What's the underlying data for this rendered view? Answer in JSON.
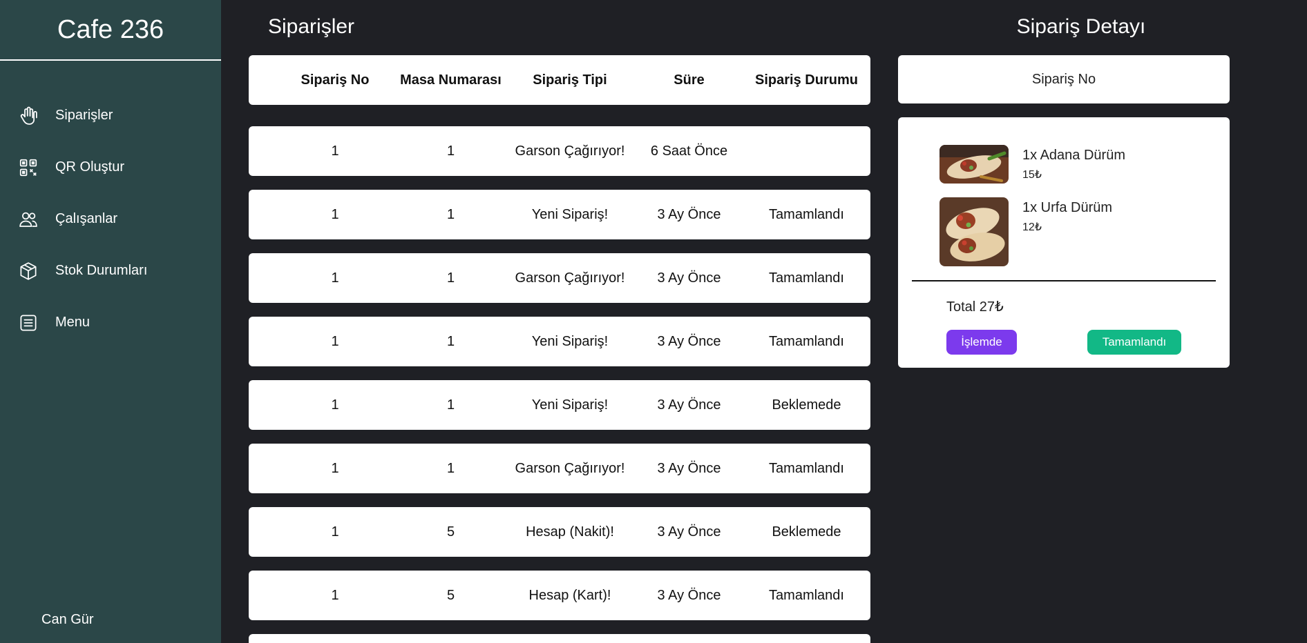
{
  "sidebar": {
    "brand": "Cafe 236",
    "items": [
      {
        "label": "Siparişler",
        "icon": "hand-icon"
      },
      {
        "label": "QR Oluştur",
        "icon": "qr-code-icon"
      },
      {
        "label": "Çalışanlar",
        "icon": "users-icon"
      },
      {
        "label": "Stok Durumları",
        "icon": "box-icon"
      },
      {
        "label": "Menu",
        "icon": "list-icon"
      }
    ],
    "user": "Can Gür"
  },
  "orders": {
    "title": "Siparişler",
    "columns": [
      "Sipariş No",
      "Masa Numarası",
      "Sipariş Tipi",
      "Süre",
      "Sipariş Durumu"
    ],
    "rows": [
      [
        "1",
        "1",
        "Garson Çağırıyor!",
        "6 Saat Önce",
        ""
      ],
      [
        "1",
        "1",
        "Yeni Sipariş!",
        "3 Ay Önce",
        "Tamamlandı"
      ],
      [
        "1",
        "1",
        "Garson Çağırıyor!",
        "3 Ay Önce",
        "Tamamlandı"
      ],
      [
        "1",
        "1",
        "Yeni Sipariş!",
        "3 Ay Önce",
        "Tamamlandı"
      ],
      [
        "1",
        "1",
        "Yeni Sipariş!",
        "3 Ay Önce",
        "Beklemede"
      ],
      [
        "1",
        "1",
        "Garson Çağırıyor!",
        "3 Ay Önce",
        "Tamamlandı"
      ],
      [
        "1",
        "5",
        "Hesap (Nakit)!",
        "3 Ay Önce",
        "Beklemede"
      ],
      [
        "1",
        "5",
        "Hesap (Kart)!",
        "3 Ay Önce",
        "Tamamlandı"
      ]
    ]
  },
  "detail": {
    "title": "Sipariş Detayı",
    "order_no_label": "Sipariş No",
    "items": [
      {
        "name": "1x Adana Dürüm",
        "price": "15₺"
      },
      {
        "name": "1x Urfa Dürüm",
        "price": "12₺"
      }
    ],
    "total": "Total 27₺",
    "btn_processing": "İşlemde",
    "btn_completed": "Tamamlandı",
    "colors": {
      "processing": "#7c3aed",
      "completed": "#12b886"
    }
  }
}
